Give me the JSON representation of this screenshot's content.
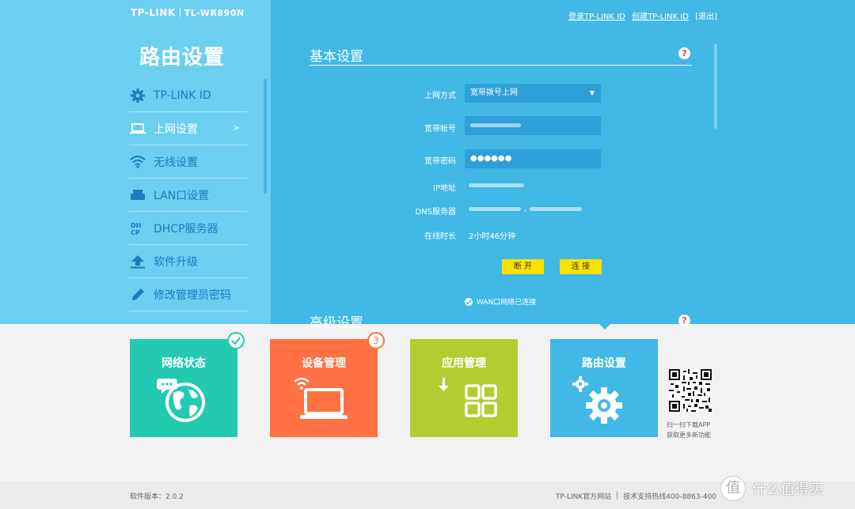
{
  "brand": {
    "logo": "TP-LINK",
    "model": "TL-WR890N"
  },
  "header_links": {
    "login": "登录TP-LINK ID",
    "create": "创建TP-LINK ID",
    "logout": "[退出]"
  },
  "sidebar": {
    "title": "路由设置",
    "items": [
      {
        "label": "TP-LINK ID",
        "icon": "gear-icon"
      },
      {
        "label": "上网设置",
        "icon": "laptop-icon",
        "active": true,
        "arrow": ">"
      },
      {
        "label": "无线设置",
        "icon": "wifi-icon"
      },
      {
        "label": "LAN口设置",
        "icon": "router-icon"
      },
      {
        "label": "DHCP服务器",
        "icon": "dhcp-icon"
      },
      {
        "label": "软件升级",
        "icon": "upload-icon"
      },
      {
        "label": "修改管理员密码",
        "icon": "pencil-icon"
      }
    ]
  },
  "basic": {
    "title": "基本设置",
    "help": "?",
    "fields": {
      "wan_type_label": "上网方式",
      "wan_type_value": "宽带拨号上网",
      "account_label": "宽带帐号",
      "password_label": "宽带密码",
      "password_value": "●●●●●●",
      "ip_label": "IP地址",
      "dns_label": "DNS服务器",
      "dns_sep": ",",
      "uptime_label": "在线时长",
      "uptime_value": "2小时46分钟"
    },
    "buttons": {
      "disconnect": "断 开",
      "connect": "连 接"
    },
    "status": "WAN口网络已连接"
  },
  "advanced": {
    "title": "高级设置",
    "help": "?"
  },
  "tiles": [
    {
      "label": "网络状态",
      "color": "#23c9b0",
      "icon": "globe-icon"
    },
    {
      "label": "设备管理",
      "color": "#ff7043",
      "icon": "laptop-wifi-icon",
      "badge": "3"
    },
    {
      "label": "应用管理",
      "color": "#b5cc31",
      "icon": "apps-icon"
    },
    {
      "label": "路由设置",
      "color": "#41b8e6",
      "icon": "gears-icon"
    }
  ],
  "qr": {
    "line1": "扫一扫下载APP",
    "line2": "获取更多新功能"
  },
  "footer": {
    "version": "软件版本：2.0.2",
    "site": "TP-LINK官方网站",
    "hotline": "技术支持热线400-8863-400"
  },
  "watermark": {
    "text": "什么值得买",
    "symbol": "值"
  },
  "colors": {
    "left_panel": "#6ccff0",
    "right_panel": "#41b8e6",
    "button_yellow": "#ffe000"
  }
}
